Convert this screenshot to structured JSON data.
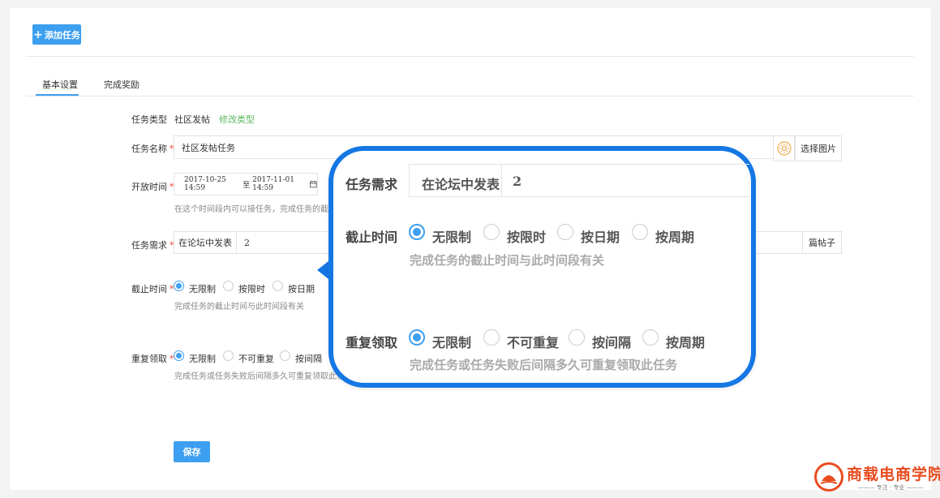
{
  "toolbar": {
    "add_task_label": "添加任务"
  },
  "tabs": [
    {
      "label": "基本设置",
      "active": true
    },
    {
      "label": "完成奖励",
      "active": false
    }
  ],
  "form": {
    "task_type": {
      "label": "任务类型",
      "value": "社区发帖",
      "action": "修改类型"
    },
    "task_name": {
      "label": "任务名称",
      "value": "社区发帖任务",
      "image_button": "选择图片"
    },
    "open_time": {
      "label": "开放时间",
      "start": "2017-10-25 14:59",
      "to": "至",
      "end": "2017-11-01 14:59",
      "hint": "在这个时间段内可以接任务，完成任务的截止时"
    },
    "requirement": {
      "label": "任务需求",
      "action": "在论坛中发表",
      "count": "2",
      "unit": "篇帖子"
    },
    "deadline": {
      "label": "截止时间",
      "options": [
        "无限制",
        "按限时",
        "按日期"
      ],
      "selected": 0,
      "hint": "完成任务的截止时间与此时间段有关"
    },
    "repeat": {
      "label": "重复领取",
      "options": [
        "无限制",
        "不可重复",
        "按间隔"
      ],
      "selected": 0,
      "hint": "完成任务或任务失败后间隔多久可重复领取此任务"
    },
    "save_label": "保存"
  },
  "callout": {
    "requirement": {
      "label": "任务需求",
      "action": "在论坛中发表",
      "count": "2"
    },
    "deadline": {
      "label": "截止时间",
      "options": [
        "无限制",
        "按限时",
        "按日期",
        "按周期"
      ],
      "selected": 0,
      "hint": "完成任务的截止时间与此时间段有关"
    },
    "repeat": {
      "label": "重复领取",
      "options": [
        "无限制",
        "不可重复",
        "按间隔",
        "按周期"
      ],
      "selected": 0,
      "hint": "完成任务或任务失败后间隔多久可重复领取此任务"
    }
  },
  "brand": {
    "name": "商载电商学院",
    "tagline": "专注 · 专业"
  },
  "colors": {
    "primary": "#3d9ff0",
    "callout_border": "#1577e4",
    "link_green": "#5cb85c",
    "required": "#e74c3c",
    "brand": "#e84c1f"
  }
}
